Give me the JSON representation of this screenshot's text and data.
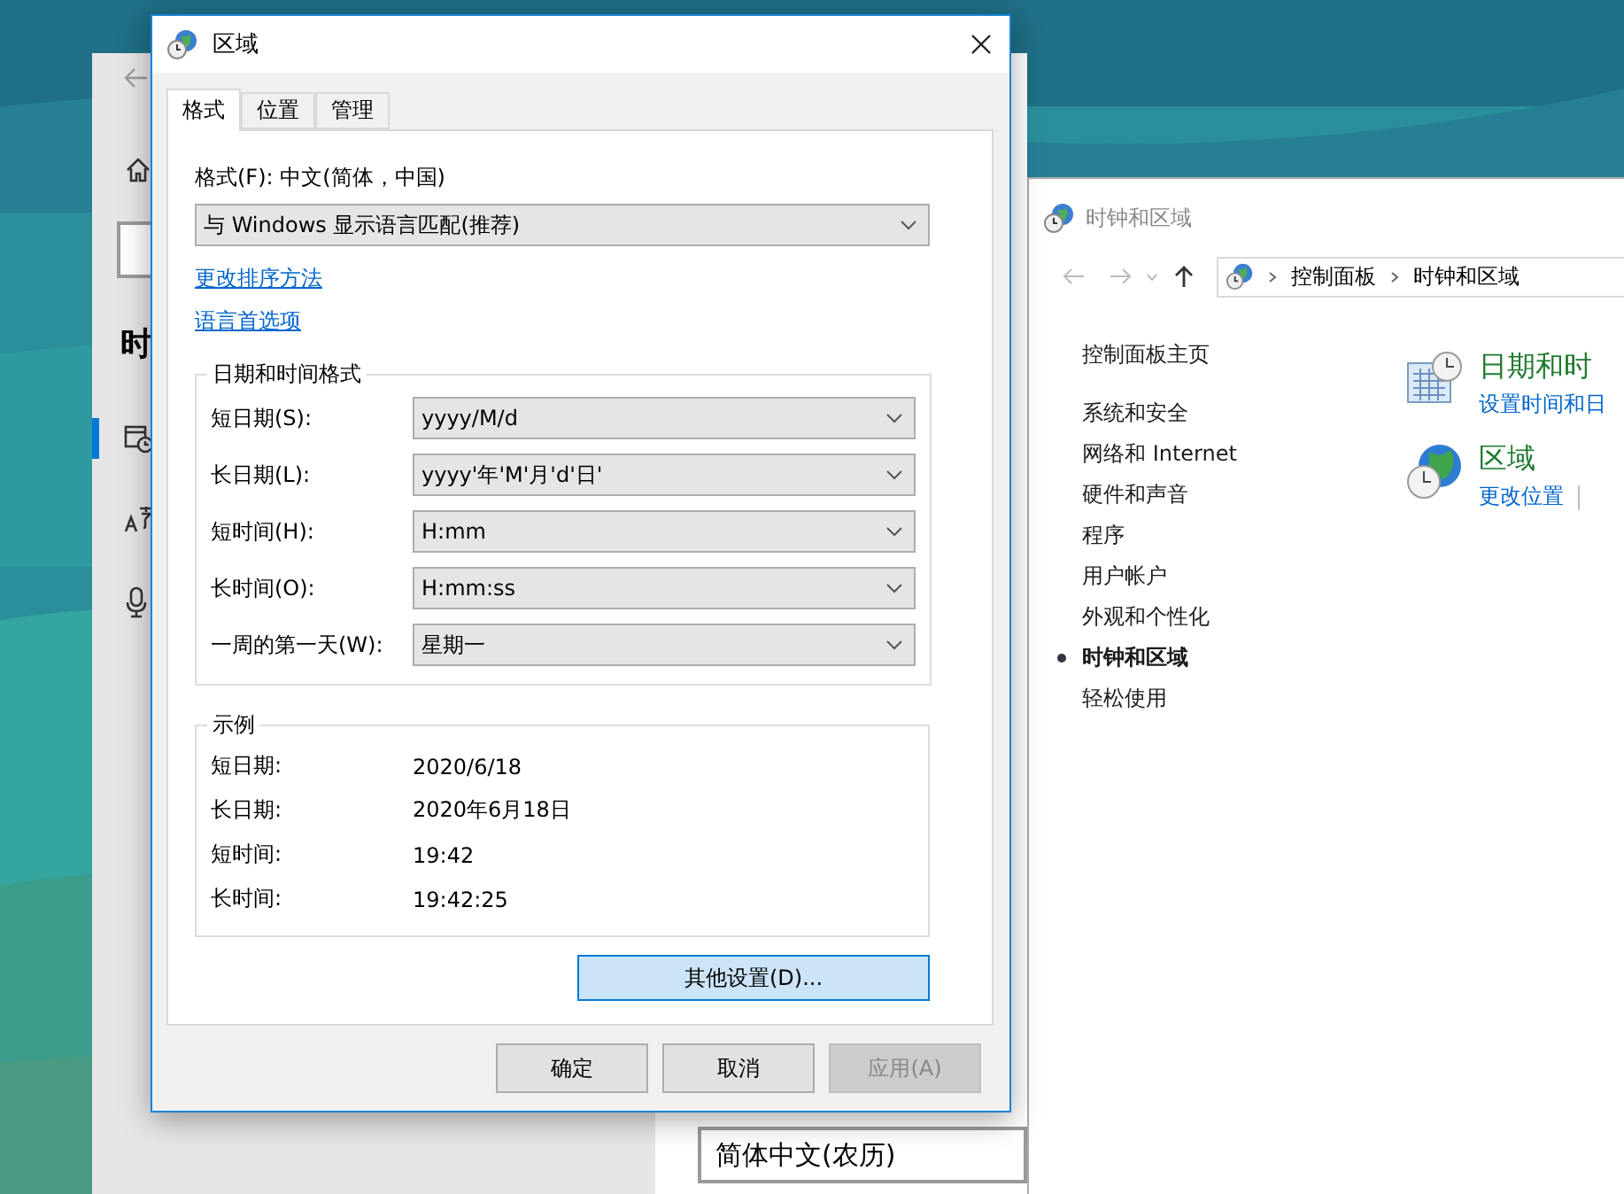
{
  "settings_window": {
    "heading": "时",
    "nav": [
      {
        "kind": "home",
        "selected": false
      },
      {
        "kind": "date",
        "selected": true
      },
      {
        "kind": "language",
        "selected": false
      },
      {
        "kind": "speech",
        "selected": false
      }
    ],
    "calendar_dropdown": {
      "value": "简体中文(农历)"
    }
  },
  "control_panel": {
    "title": "时钟和区域",
    "breadcrumb": [
      "控制面板",
      "时钟和区域"
    ],
    "home_link": "控制面板主页",
    "sidebar": [
      {
        "label": "系统和安全",
        "selected": false
      },
      {
        "label": "网络和 Internet",
        "selected": false
      },
      {
        "label": "硬件和声音",
        "selected": false
      },
      {
        "label": "程序",
        "selected": false
      },
      {
        "label": "用户帐户",
        "selected": false
      },
      {
        "label": "外观和个性化",
        "selected": false
      },
      {
        "label": "时钟和区域",
        "selected": true
      },
      {
        "label": "轻松使用",
        "selected": false
      }
    ],
    "categories": [
      {
        "kind": "datetime",
        "title": "日期和时",
        "links": [
          "设置时间和日"
        ]
      },
      {
        "kind": "region",
        "title": "区域",
        "links": [
          "更改位置"
        ]
      }
    ]
  },
  "region_dialog": {
    "title": "区域",
    "tabs": [
      {
        "label": "格式",
        "selected": true
      },
      {
        "label": "位置",
        "selected": false
      },
      {
        "label": "管理",
        "selected": false
      }
    ],
    "format_label": "格式(F): 中文(简体，中国)",
    "format_dropdown": "与 Windows 显示语言匹配(推荐)",
    "links": [
      "更改排序方法",
      "语言首选项"
    ],
    "formats_group": {
      "title": "日期和时间格式",
      "rows": [
        {
          "label": "短日期(S):",
          "value": "yyyy/M/d"
        },
        {
          "label": "长日期(L):",
          "value": "yyyy'年'M'月'd'日'"
        },
        {
          "label": "短时间(H):",
          "value": "H:mm"
        },
        {
          "label": "长时间(O):",
          "value": "H:mm:ss"
        },
        {
          "label": "一周的第一天(W):",
          "value": "星期一"
        }
      ]
    },
    "examples_group": {
      "title": "示例",
      "rows": [
        {
          "label": "短日期:",
          "value": "2020/6/18"
        },
        {
          "label": "长日期:",
          "value": "2020年6月18日"
        },
        {
          "label": "短时间:",
          "value": "19:42"
        },
        {
          "label": "长时间:",
          "value": "19:42:25"
        }
      ]
    },
    "other_settings_button": "其他设置(D)...",
    "buttons": [
      {
        "label": "确定",
        "disabled": false
      },
      {
        "label": "取消",
        "disabled": false
      },
      {
        "label": "应用(A)",
        "disabled": true
      }
    ]
  }
}
